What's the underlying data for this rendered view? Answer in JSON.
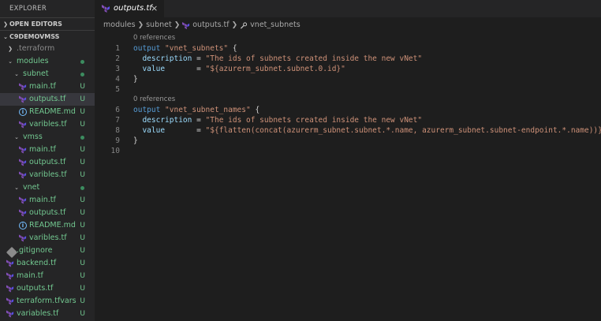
{
  "sidebar": {
    "title": "EXPLORER",
    "open_editors": "OPEN EDITORS",
    "project": "C9DEMOVMSS"
  },
  "tree": [
    {
      "name": ".terraform",
      "depth": 1,
      "kind": "folder-closed",
      "badge": "",
      "dim": true
    },
    {
      "name": "modules",
      "depth": 1,
      "kind": "folder-open",
      "badge": "dot"
    },
    {
      "name": "subnet",
      "depth": 2,
      "kind": "folder-open",
      "badge": "dot"
    },
    {
      "name": "main.tf",
      "depth": 3,
      "kind": "tf",
      "badge": "U"
    },
    {
      "name": "outputs.tf",
      "depth": 3,
      "kind": "tf",
      "badge": "U",
      "selected": true
    },
    {
      "name": "README.md",
      "depth": 3,
      "kind": "info",
      "badge": "U"
    },
    {
      "name": "varibles.tf",
      "depth": 3,
      "kind": "tf",
      "badge": "U"
    },
    {
      "name": "vmss",
      "depth": 2,
      "kind": "folder-open",
      "badge": "dot"
    },
    {
      "name": "main.tf",
      "depth": 3,
      "kind": "tf",
      "badge": "U"
    },
    {
      "name": "outputs.tf",
      "depth": 3,
      "kind": "tf",
      "badge": "U"
    },
    {
      "name": "varibles.tf",
      "depth": 3,
      "kind": "tf",
      "badge": "U"
    },
    {
      "name": "vnet",
      "depth": 2,
      "kind": "folder-open",
      "badge": "dot"
    },
    {
      "name": "main.tf",
      "depth": 3,
      "kind": "tf",
      "badge": "U"
    },
    {
      "name": "outputs.tf",
      "depth": 3,
      "kind": "tf",
      "badge": "U"
    },
    {
      "name": "README.md",
      "depth": 3,
      "kind": "info",
      "badge": "U"
    },
    {
      "name": "varibles.tf",
      "depth": 3,
      "kind": "tf",
      "badge": "U"
    },
    {
      "name": ".gitignore",
      "depth": 1,
      "kind": "git",
      "badge": "U"
    },
    {
      "name": "backend.tf",
      "depth": 1,
      "kind": "tf",
      "badge": "U"
    },
    {
      "name": "main.tf",
      "depth": 1,
      "kind": "tf",
      "badge": "U"
    },
    {
      "name": "outputs.tf",
      "depth": 1,
      "kind": "tf",
      "badge": "U"
    },
    {
      "name": "terraform.tfvars",
      "depth": 1,
      "kind": "tf",
      "badge": "U"
    },
    {
      "name": "variables.tf",
      "depth": 1,
      "kind": "tf",
      "badge": "U"
    }
  ],
  "tab": {
    "label": "outputs.tf",
    "close": "×"
  },
  "breadcrumb": {
    "part1": "modules",
    "part2": "subnet",
    "part3": "outputs.tf",
    "part4": "vnet_subnets"
  },
  "code": [
    {
      "lens": "0 references"
    },
    {
      "n": "1",
      "t": [
        [
          "kw",
          "output "
        ],
        [
          "str",
          "\"vnet_subnets\""
        ],
        [
          "pl",
          " {"
        ]
      ]
    },
    {
      "n": "2",
      "t": [
        [
          "pl",
          "  "
        ],
        [
          "at",
          "description"
        ],
        [
          "pl",
          " = "
        ],
        [
          "str",
          "\"The ids of subnets created inside the new vNet\""
        ]
      ]
    },
    {
      "n": "3",
      "t": [
        [
          "pl",
          "  "
        ],
        [
          "at",
          "value"
        ],
        [
          "pl",
          "       = "
        ],
        [
          "str",
          "\"${azurerm_subnet.subnet.0.id}\""
        ]
      ]
    },
    {
      "n": "4",
      "t": [
        [
          "pl",
          "}"
        ]
      ]
    },
    {
      "n": "5",
      "t": []
    },
    {
      "lens": "0 references"
    },
    {
      "n": "6",
      "t": [
        [
          "kw",
          "output "
        ],
        [
          "str",
          "\"vnet_subnet_names\""
        ],
        [
          "pl",
          " {"
        ]
      ]
    },
    {
      "n": "7",
      "t": [
        [
          "pl",
          "  "
        ],
        [
          "at",
          "description"
        ],
        [
          "pl",
          " = "
        ],
        [
          "str",
          "\"The ids of subnets created inside the new vNet\""
        ]
      ]
    },
    {
      "n": "8",
      "t": [
        [
          "pl",
          "  "
        ],
        [
          "at",
          "value"
        ],
        [
          "pl",
          "       = "
        ],
        [
          "str",
          "\"${flatten(concat(azurerm_subnet.subnet.*.name, azurerm_subnet.subnet-endpoint.*.name))}\""
        ]
      ]
    },
    {
      "n": "9",
      "t": [
        [
          "pl",
          "}"
        ]
      ]
    },
    {
      "n": "10",
      "t": []
    }
  ],
  "colors": {
    "accent": "#73c991",
    "terraform": "#844fba",
    "keyword": "#569cd6",
    "string": "#ce9178"
  }
}
